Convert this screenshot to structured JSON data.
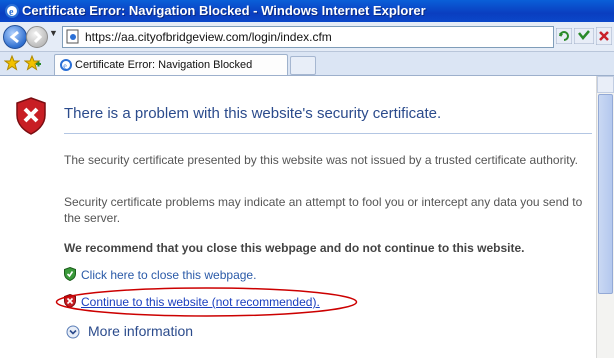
{
  "window": {
    "title": "Certificate Error: Navigation Blocked - Windows Internet Explorer"
  },
  "toolbar": {
    "url": "https://aa.cityofbridgeview.com/login/index.cfm",
    "icons": [
      "back-icon",
      "forward-icon",
      "page-icon",
      "refresh-icon",
      "go-icon",
      "stop-icon"
    ]
  },
  "tabs": [
    {
      "label": "Certificate Error: Navigation Blocked"
    }
  ],
  "content": {
    "heading": "There is a problem with this website's security certificate.",
    "paragraph1": "The security certificate presented by this website was not issued by a trusted certificate authority.",
    "paragraph2": "Security certificate problems may indicate an attempt to fool you or intercept any data you send to the server.",
    "recommendation": "We recommend that you close this webpage and do not continue to this website.",
    "close_link": "Click here to close this webpage.",
    "continue_link": "Continue to this website (not recommended).",
    "more_info": "More information"
  },
  "colors": {
    "titlebar": "#0a4fd0",
    "heading": "#2b4b8c",
    "link": "#1a3fbf",
    "highlight_ellipse": "#cc0000"
  }
}
